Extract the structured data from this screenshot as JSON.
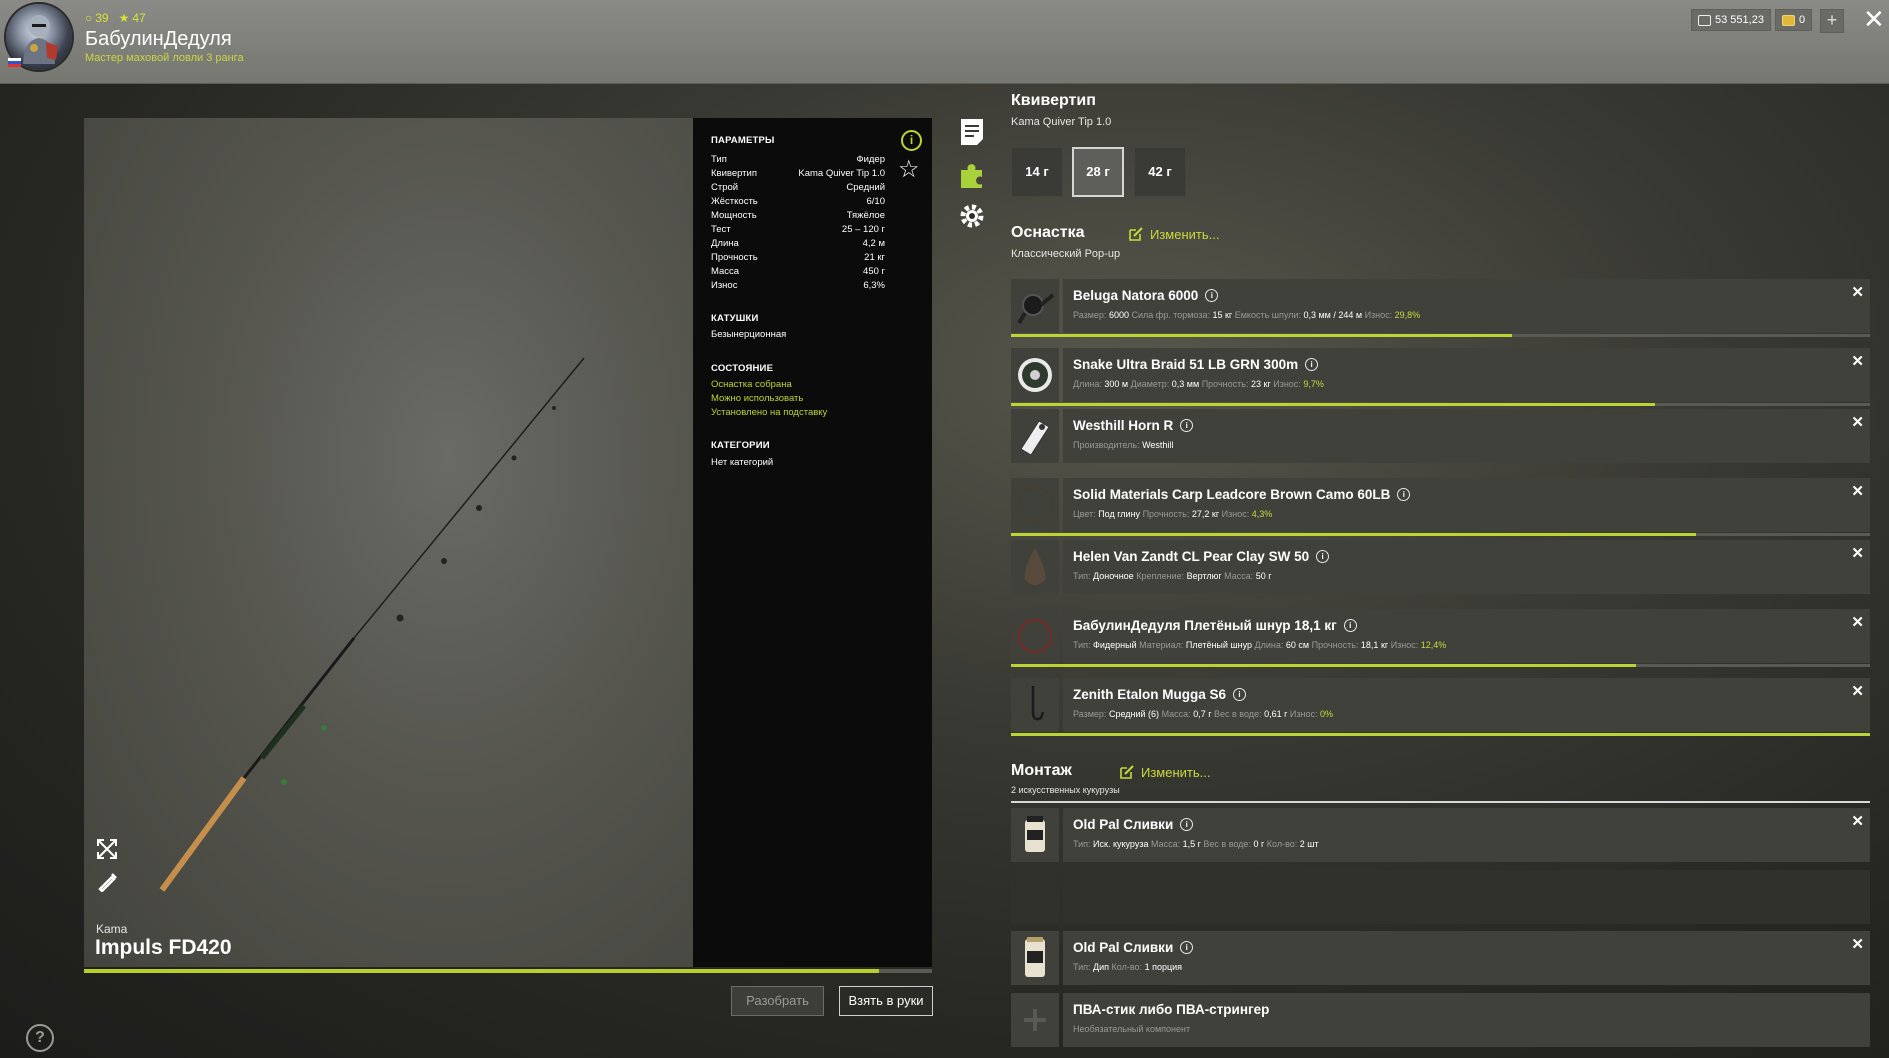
{
  "player": {
    "level": "39",
    "stars": "47",
    "nickname": "БабулинДедуля",
    "rank": "Мастер маховой ловли 3 ранга"
  },
  "currency": {
    "silver": "53 551,23",
    "gold": "0"
  },
  "rod": {
    "brand": "Kama",
    "name": "Impuls FD420",
    "wear_fraction": 0.937
  },
  "params": {
    "title": "ПАРАМЕТРЫ",
    "rows": [
      {
        "k": "Тип",
        "v": "Фидер"
      },
      {
        "k": "Квивертип",
        "v": "Kama Quiver Tip 1.0"
      },
      {
        "k": "Строй",
        "v": "Средний"
      },
      {
        "k": "Жёсткость",
        "v": "6/10"
      },
      {
        "k": "Мощность",
        "v": "Тяжёлое"
      },
      {
        "k": "Тест",
        "v": "25 – 120 г"
      },
      {
        "k": "Длина",
        "v": "4,2 м"
      },
      {
        "k": "Прочность",
        "v": "21 кг"
      },
      {
        "k": "Масса",
        "v": "450 г"
      },
      {
        "k": "Износ",
        "v": "6,3%"
      }
    ],
    "reels_title": "КАТУШКИ",
    "reels_value": "Безынерционная",
    "state_title": "СОСТОЯНИЕ",
    "state_1": "Оснастка собрана",
    "state_2": "Можно использовать",
    "state_3": "Установлено на подставку",
    "categories_title": "КАТЕГОРИИ",
    "categories_value": "Нет категорий"
  },
  "buttons": {
    "disassemble": "Разобрать",
    "take": "Взять в руки"
  },
  "quiver": {
    "title": "Квивертип",
    "subtitle": "Kama Quiver Tip 1.0",
    "options": [
      "14 г",
      "28 г",
      "42 г"
    ],
    "selected": "28 г"
  },
  "tackle": {
    "title": "Оснастка",
    "change": "Изменить...",
    "subtitle": "Классический Pop-up",
    "items": [
      {
        "name": "Beluga Natora 6000",
        "wear": 0.583,
        "d": [
          [
            "Размер:",
            "6000"
          ],
          [
            "Сила фр. тормоза:",
            "15 кг"
          ],
          [
            "Емкость шпули:",
            "0,3 мм / 244 м"
          ],
          [
            "Износ:",
            "29,8%"
          ]
        ]
      },
      {
        "name": "Snake Ultra Braid 51 LB GRN 300m",
        "wear": 0.75,
        "d": [
          [
            "Длина:",
            "300 м"
          ],
          [
            "Диаметр:",
            "0,3 мм"
          ],
          [
            "Прочность:",
            "23 кг"
          ],
          [
            "Износ:",
            "9,7%"
          ]
        ]
      },
      {
        "name": "Westhill Horn R",
        "wear": null,
        "d": [
          [
            "Производитель:",
            "Westhill"
          ]
        ]
      },
      {
        "name": "Solid Materials Carp Leadcore Brown Camo 60LB",
        "wear": 0.797,
        "d": [
          [
            "Цвет:",
            "Под глину"
          ],
          [
            "Прочность:",
            "27,2 кг"
          ],
          [
            "Износ:",
            "4,3%"
          ]
        ]
      },
      {
        "name": "Helen Van Zandt CL Pear Clay SW 50",
        "wear": null,
        "d": [
          [
            "Тип:",
            "Доночное"
          ],
          [
            "Крепление:",
            "Вертлюг"
          ],
          [
            "Масса:",
            "50 г"
          ]
        ]
      },
      {
        "name": "БабулинДедуля Плетёный шнур 18,1 кг",
        "wear": 0.728,
        "d": [
          [
            "Тип:",
            "Фидерный"
          ],
          [
            "Материал:",
            "Плетёный шнур"
          ],
          [
            "Длина:",
            "60 см"
          ],
          [
            "Прочность:",
            "18,1 кг"
          ],
          [
            "Износ:",
            "12,4%"
          ]
        ]
      },
      {
        "name": "Zenith Etalon Mugga S6",
        "wear": 1.0,
        "d": [
          [
            "Размер:",
            "Средний (6)"
          ],
          [
            "Масса:",
            "0,7 г"
          ],
          [
            "Вес в воде:",
            "0,61 г"
          ],
          [
            "Износ:",
            "0%"
          ]
        ]
      }
    ]
  },
  "montage": {
    "title": "Монтаж",
    "change": "Изменить...",
    "subtitle": "2 искусственных кукурузы",
    "items": [
      {
        "name": "Old Pal Сливки",
        "d": [
          [
            "Тип:",
            "Иск. кукуруза"
          ],
          [
            "Масса:",
            "1,5 г"
          ],
          [
            "Вес в воде:",
            "0 г"
          ],
          [
            "Кол-во:",
            "2 шт"
          ]
        ]
      },
      {
        "name": "Old Pal Сливки",
        "d": [
          [
            "Тип:",
            "Дип"
          ],
          [
            "Кол-во:",
            "1 порция"
          ]
        ]
      },
      {
        "name": "ПВА-стик либо ПВА-стрингер",
        "d": [
          [
            "Необязательный компонент",
            ""
          ]
        ]
      }
    ]
  },
  "colors": {
    "accent": "#bdd534",
    "panel": "#41413c",
    "params_bg": "#0b0b0b"
  },
  "icons": [
    "level-icon",
    "star-icon",
    "silver-coin-icon",
    "gold-coin-icon",
    "plus-icon",
    "close-icon",
    "info-icon",
    "favorite-star-icon",
    "notes-icon",
    "puzzle-icon",
    "gear-icon",
    "expand-icon",
    "brush-icon",
    "help-icon",
    "edit-icon",
    "remove-icon"
  ]
}
